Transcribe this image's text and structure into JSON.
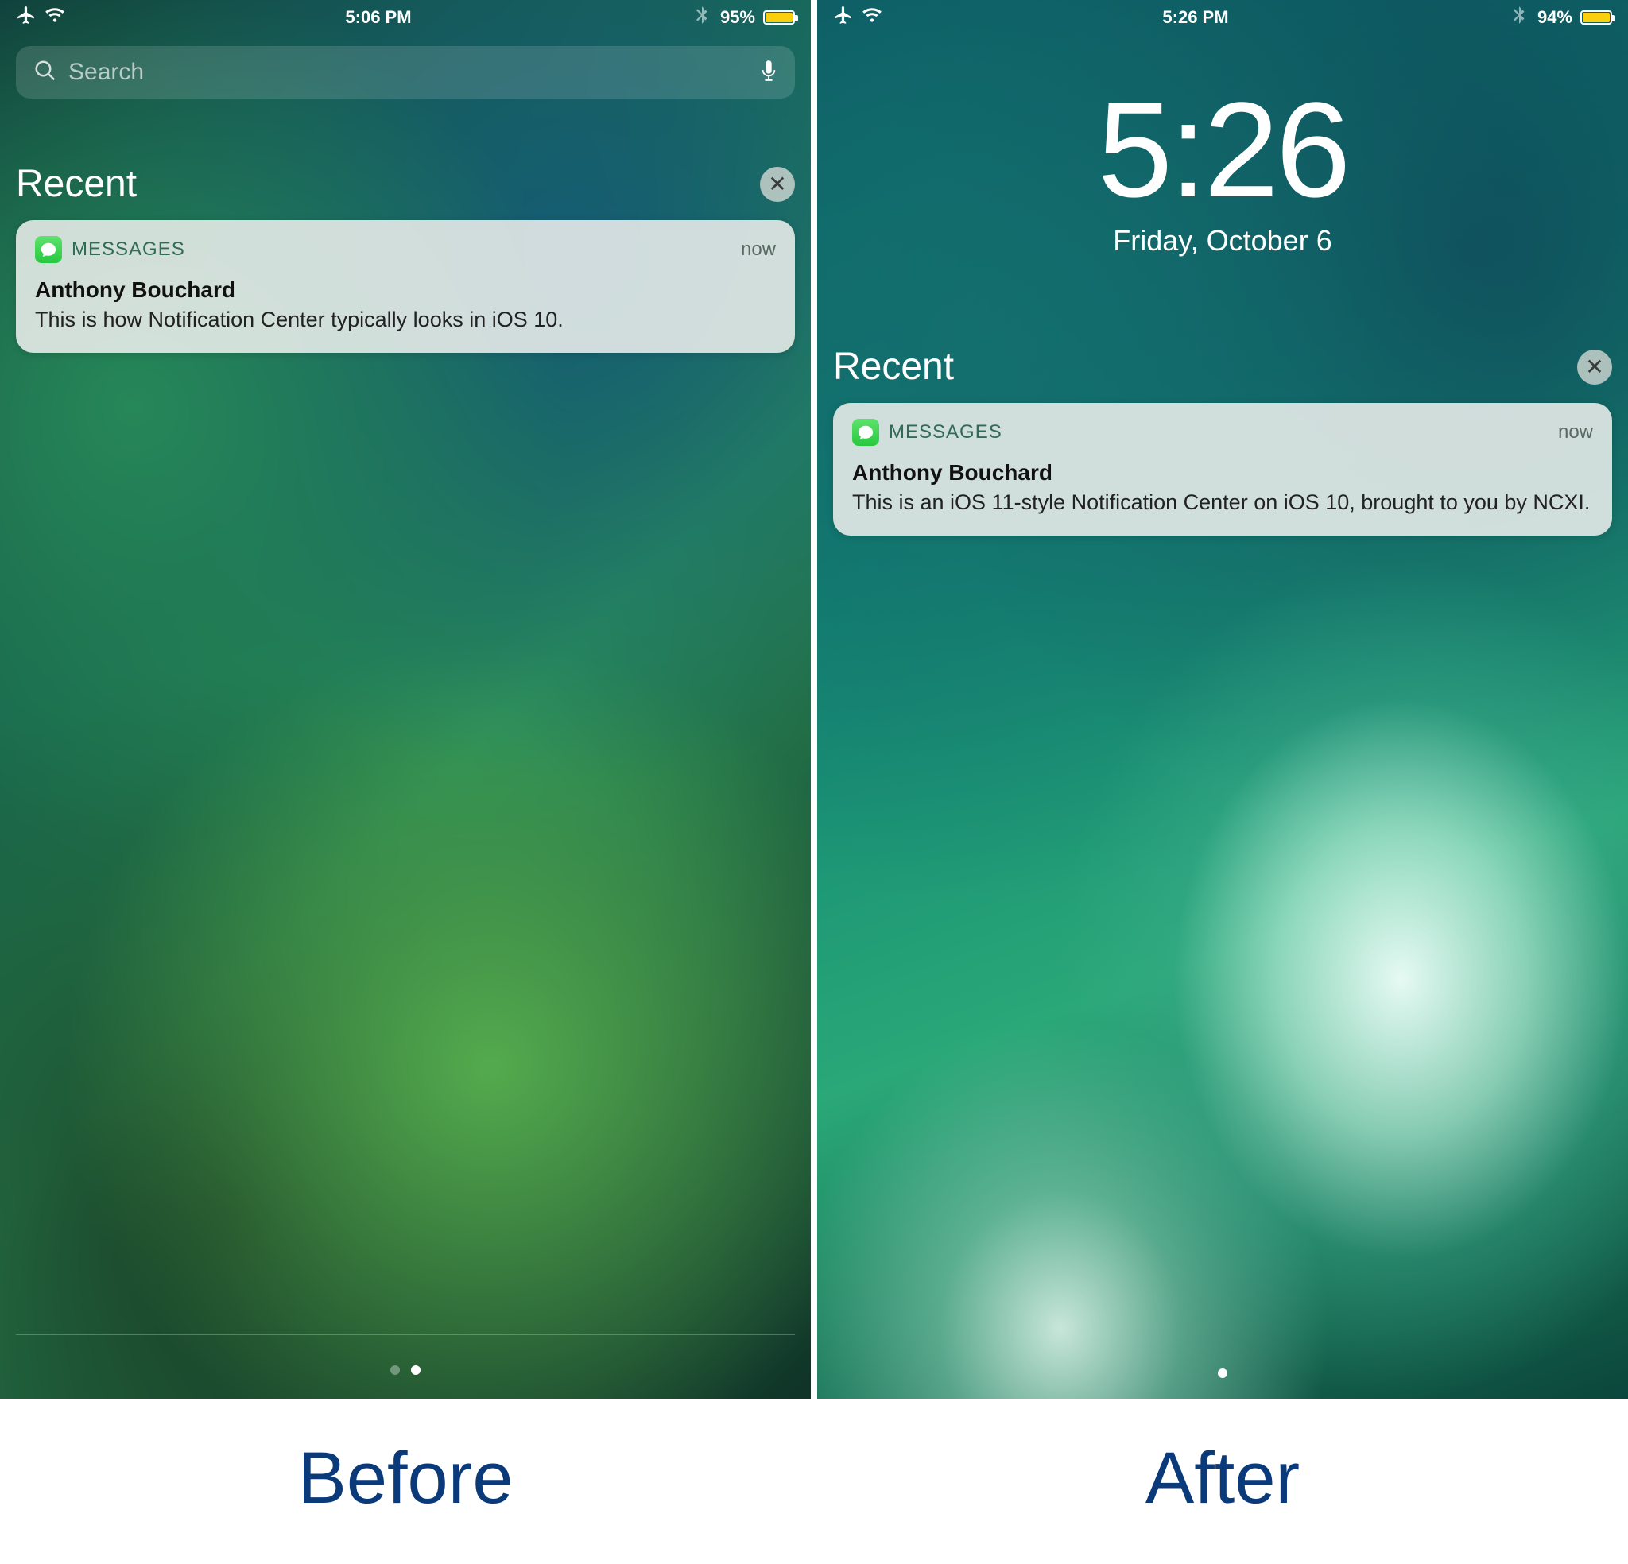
{
  "captions": {
    "left": "Before",
    "right": "After"
  },
  "left": {
    "status": {
      "time": "5:06 PM",
      "battery_pct": "95%",
      "battery_fill": 95
    },
    "search": {
      "placeholder": "Search"
    },
    "section_title": "Recent",
    "notif": {
      "app": "MESSAGES",
      "when": "now",
      "title": "Anthony Bouchard",
      "body": "This is how Notification Center typically looks in iOS 10."
    }
  },
  "right": {
    "status": {
      "time": "5:26 PM",
      "battery_pct": "94%",
      "battery_fill": 94
    },
    "clock": {
      "time": "5:26",
      "date": "Friday, October 6"
    },
    "section_title": "Recent",
    "notif": {
      "app": "MESSAGES",
      "when": "now",
      "title": "Anthony Bouchard",
      "body": "This is an iOS 11-style Notification Center on iOS 10, brought to you by NCXI."
    }
  }
}
